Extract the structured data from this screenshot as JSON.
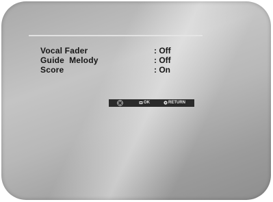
{
  "menu": {
    "items": [
      {
        "label": "Vocal Fader",
        "value": ": Off"
      },
      {
        "label": "Guide  Melody",
        "value": ": Off"
      },
      {
        "label": "Score",
        "value": ": On"
      }
    ]
  },
  "nav": {
    "move_icon": "directional-pad-icon",
    "ok_icon": "enter-icon",
    "ok_label": "OK",
    "return_icon": "return-icon",
    "return_label": "RETURN"
  },
  "colors": {
    "screen_light": "#c4c4c4",
    "screen_dark": "#8e8e8e",
    "text": "#151515",
    "nav_bg": "#2b2b2b",
    "nav_text": "#e8e8e8"
  }
}
